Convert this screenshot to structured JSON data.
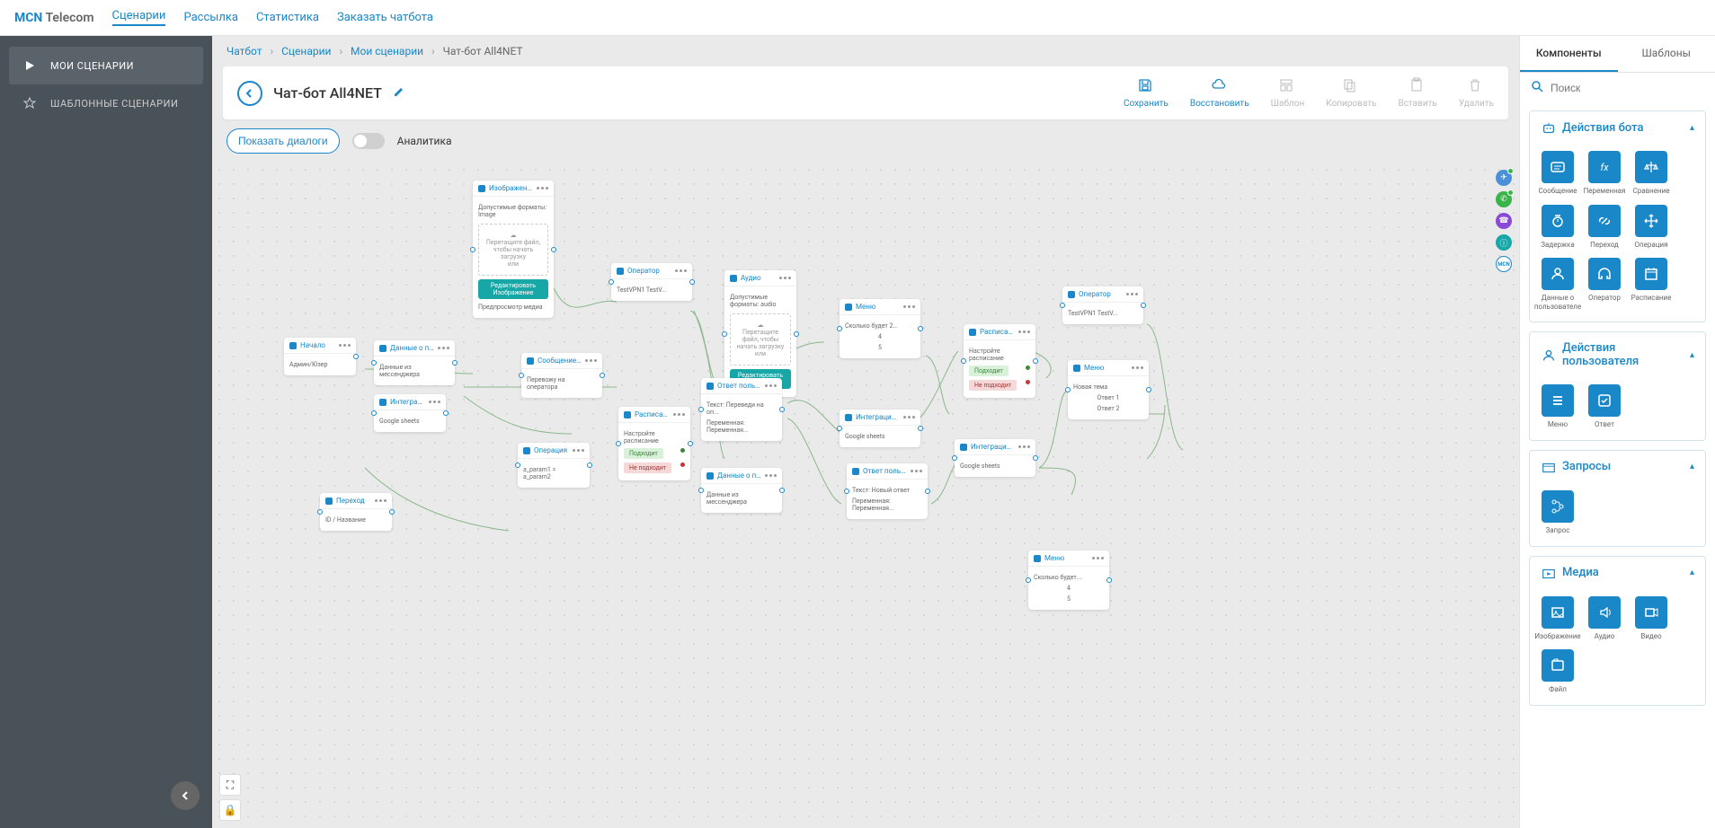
{
  "logo": {
    "p1": "MCN",
    "p2": "Telecom"
  },
  "topnav": [
    {
      "label": "Сценарии",
      "active": true
    },
    {
      "label": "Рассылка"
    },
    {
      "label": "Статистика"
    },
    {
      "label": "Заказать чатбота"
    }
  ],
  "sidebar": [
    {
      "label": "МОИ СЦЕНАРИИ",
      "icon": "play",
      "active": true
    },
    {
      "label": "ШАБЛОННЫЕ СЦЕНАРИИ",
      "icon": "star"
    }
  ],
  "breadcrumb": [
    {
      "label": "Чатбот"
    },
    {
      "label": "Сценарии"
    },
    {
      "label": "Мои сценарии"
    },
    {
      "label": "Чат-бот All4NET",
      "current": true
    }
  ],
  "title": "Чат-бот All4NET",
  "toolbar": [
    {
      "label": "Сохранить",
      "icon": "save",
      "en": true
    },
    {
      "label": "Восстановить",
      "icon": "cloud",
      "en": true
    },
    {
      "label": "Шаблон",
      "icon": "template",
      "en": false
    },
    {
      "label": "Копировать",
      "icon": "copy",
      "en": false
    },
    {
      "label": "Вставить",
      "icon": "paste",
      "en": false
    },
    {
      "label": "Удалить",
      "icon": "trash",
      "en": false
    }
  ],
  "controls": {
    "show_dialogs": "Показать диалоги",
    "analytics": "Аналитика"
  },
  "search_placeholder": "Поиск",
  "right_tabs": [
    {
      "label": "Компоненты",
      "active": true
    },
    {
      "label": "Шаблоны"
    }
  ],
  "groups": [
    {
      "title": "Действия бота",
      "icon": "bot",
      "items": [
        {
          "label": "Сообщение",
          "icon": "msg"
        },
        {
          "label": "Переменная",
          "icon": "fx"
        },
        {
          "label": "Сравнение",
          "icon": "scale"
        },
        {
          "label": "Задержка",
          "icon": "timer"
        },
        {
          "label": "Переход",
          "icon": "link"
        },
        {
          "label": "Операция",
          "icon": "move"
        },
        {
          "label": "Данные о пользователе",
          "icon": "userdata"
        },
        {
          "label": "Оператор",
          "icon": "headset"
        },
        {
          "label": "Расписание",
          "icon": "calendar"
        }
      ]
    },
    {
      "title": "Действия пользователя",
      "icon": "user",
      "items": [
        {
          "label": "Меню",
          "icon": "menu"
        },
        {
          "label": "Ответ",
          "icon": "answer"
        }
      ]
    },
    {
      "title": "Запросы",
      "icon": "req",
      "items": [
        {
          "label": "Запрос",
          "icon": "branch"
        }
      ]
    },
    {
      "title": "Медиа",
      "icon": "media",
      "items": [
        {
          "label": "Изображение",
          "icon": "image"
        },
        {
          "label": "Аудио",
          "icon": "audio"
        },
        {
          "label": "Видео",
          "icon": "video"
        },
        {
          "label": "Файл",
          "icon": "file"
        }
      ]
    }
  ],
  "nodes": {
    "n_image": {
      "title": "Изображение",
      "fmt": "Допустимые форматы: Image",
      "drop": "Перетащите файл, чтобы начать загрузку",
      "or": "или",
      "btn": "Редактировать Изображение",
      "preview": "Предпросмотр медиа"
    },
    "n_start": {
      "title": "Начало",
      "body": "Админ/Юзер"
    },
    "n_userdata": {
      "title": "Данные о пользова...",
      "body": "Данные из мессенджера"
    },
    "n_integr": {
      "title": "Интеграция с G...",
      "body": "Google sheets"
    },
    "n_operator": {
      "title": "Оператор",
      "body": "TestVPN1 TestV..."
    },
    "n_msgbot": {
      "title": "Сообщение бот...",
      "body": "Перевожу на оператора"
    },
    "n_op2": {
      "title": "Операция",
      "body": "a_param1 = a_param2"
    },
    "n_goto": {
      "title": "Переход",
      "body": "ID / Название"
    },
    "n_audio": {
      "title": "Аудио",
      "fmt": "Допустимые форматы: audio",
      "drop": "Перетащите файл, чтобы начать загрузку",
      "or": "или",
      "btn": "Редактировать Аудио"
    },
    "n_sched": {
      "title": "Расписание",
      "body": "Настройте расписание",
      "ok": "Подходит",
      "no": "Не подходит"
    },
    "n_answer": {
      "title": "Ответ пользова...",
      "l1": "Текст: Переведи на оп...",
      "l2": "Переменная: Переменная..."
    },
    "n_userdata2": {
      "title": "Данные о пользова...",
      "body": "Данные из мессенджера"
    },
    "n_menu": {
      "title": "Меню",
      "body": "Сколько будет 2...",
      "a": "4",
      "b": "5"
    },
    "n_integr2": {
      "title": "Интеграция с G...",
      "body": "Google sheets"
    },
    "n_answer2": {
      "title": "Ответ пользова...",
      "l1": "Текст: Новый ответ",
      "l2": "Переменная: Переменная..."
    },
    "n_integr3": {
      "title": "Интеграция с G...",
      "body": "Google sheets"
    },
    "n_sched2": {
      "title": "Расписание",
      "body": "Настройте расписание",
      "ok": "Подходит",
      "no": "Не подходит"
    },
    "n_operator2": {
      "title": "Оператор",
      "body": "TestVPN1 TestV..."
    },
    "n_menu2": {
      "title": "Меню",
      "body": "Новая тема",
      "a": "Ответ 1",
      "b": "Ответ 2"
    },
    "n_menu3": {
      "title": "Меню",
      "body": "Сколько будет...",
      "a": "4",
      "b": "5"
    }
  }
}
